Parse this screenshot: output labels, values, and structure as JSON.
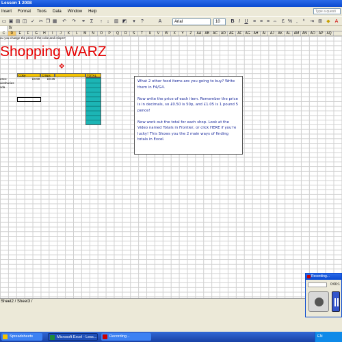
{
  "window": {
    "title": "Lesson 1 2008"
  },
  "menu": {
    "items": [
      "Insert",
      "Format",
      "Tools",
      "Data",
      "Window",
      "Help"
    ],
    "question_placeholder": "Type a questi"
  },
  "toolbar": {
    "font": "Arial",
    "size": "10"
  },
  "columns": [
    "C",
    "D",
    "E",
    "F",
    "G",
    "H",
    "I",
    "J",
    "K",
    "L",
    "M",
    "N",
    "O",
    "P",
    "Q",
    "R",
    "S",
    "T",
    "U",
    "V",
    "W",
    "X",
    "Y",
    "Z",
    "AA",
    "AB",
    "AC",
    "AD",
    "AE",
    "AF",
    "AG",
    "AH",
    "AI",
    "AJ",
    "AK",
    "AL",
    "AM",
    "AN",
    "AO",
    "AP",
    "AQ"
  ],
  "sheet": {
    "question": "ou you change the price of the coke and crisps?",
    "title": "Shopping WARZ",
    "headers": {
      "coke": "Coke",
      "crisps": "Crisps",
      "total": "TOTAL"
    },
    "rows": [
      {
        "label": "esco",
        "coke": "£0.50",
        "crisps": "£0.25"
      },
      {
        "label": "ainsburies",
        "coke": "",
        "crisps": ""
      },
      {
        "label": "sda",
        "coke": "",
        "crisps": ""
      }
    ]
  },
  "instructions": {
    "p1": "What 2 other food items are you going to buy? Write them in F4/G4.",
    "p2": "Now write the price of each item. Remember the price is in decimals, so £0.50 is 50p, and £1.05 is 1 pound 5 pence!",
    "p3": "Now work out the total for each shop. Look at the Video named Totals in Frontier, or click HERE if you're lucky! This Shows you the 2 main ways of finding totals in Excel."
  },
  "sheet_tabs": "Sheet2 / Sheet3 /",
  "recording": {
    "title": "Recording...",
    "time": "0:00:1"
  },
  "taskbar": {
    "items": [
      "Spreadsheets",
      "Microsoft Excel - Less...",
      "Recording..."
    ],
    "tray": "EN"
  },
  "colors": {
    "title_red": "#e60000",
    "header_yellow": "#f5c400",
    "total_teal": "#1cb5b5",
    "text_blue": "#1a2a9c"
  }
}
